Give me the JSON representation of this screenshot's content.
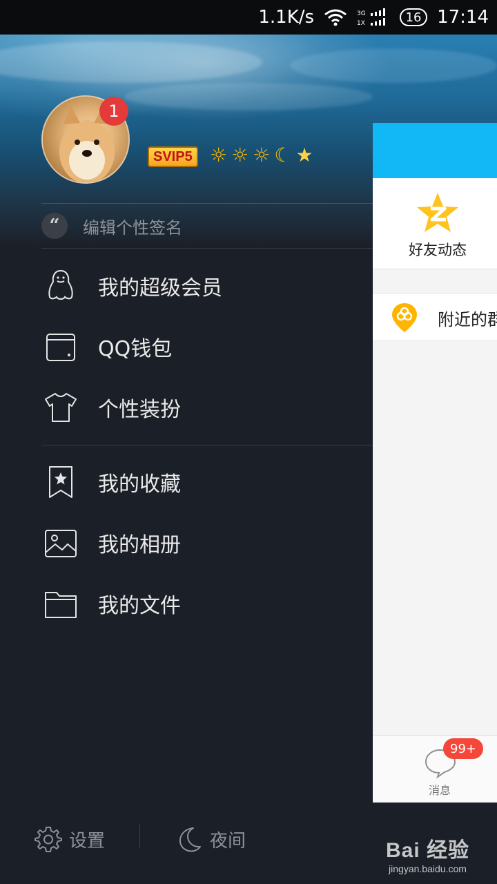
{
  "status_bar": {
    "speed": "1.1K/s",
    "network": "3G 1X",
    "battery": "16",
    "time": "17:14"
  },
  "profile": {
    "avatar_badge": "1",
    "vip_badge": "SVIP5",
    "level_icons": [
      "sun-icon",
      "sun-icon",
      "sun-icon",
      "moon-icon",
      "star-icon"
    ],
    "signature_placeholder": "编辑个性签名"
  },
  "menu": {
    "items": [
      {
        "label": "我的超级会员",
        "icon": "penguin-icon"
      },
      {
        "label": "QQ钱包",
        "icon": "wallet-icon"
      },
      {
        "label": "个性装扮",
        "icon": "tshirt-icon"
      },
      {
        "label": "我的收藏",
        "icon": "bookmark-star-icon"
      },
      {
        "label": "我的相册",
        "icon": "photo-icon"
      },
      {
        "label": "我的文件",
        "icon": "folder-icon"
      }
    ]
  },
  "panel": {
    "feed_label": "好友动态",
    "nearby_label": "附近的群",
    "message_tab_label": "消息",
    "message_badge": "99+"
  },
  "bottom": {
    "settings_label": "设置",
    "night_label": "夜间"
  },
  "watermark": {
    "main": "Bai 经验",
    "sub": "jingyan.baidu.com"
  },
  "colors": {
    "drawer_bg": "#1b1f27",
    "accent_blue": "#12b7f5",
    "badge_red": "#f4473a",
    "vip_gold": "#f5a623"
  }
}
